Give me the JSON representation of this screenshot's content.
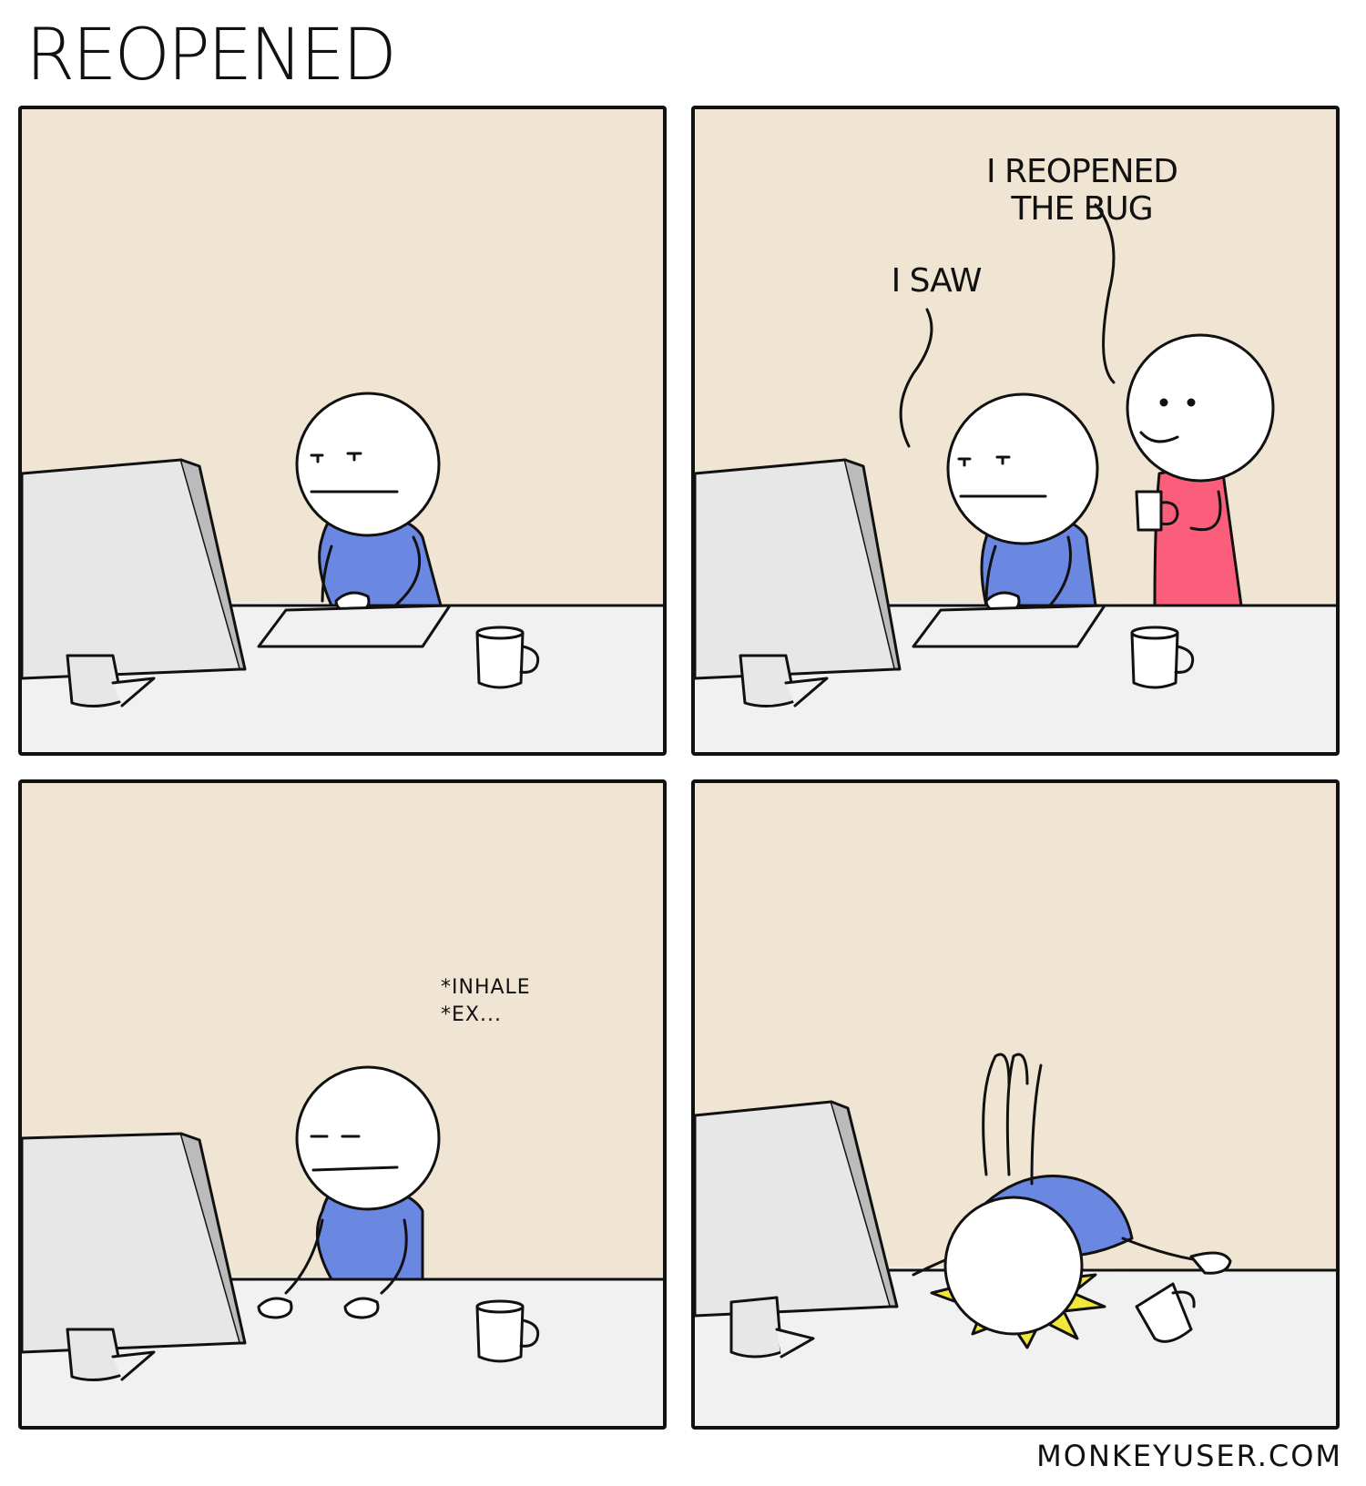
{
  "comic": {
    "title": "REOPENED",
    "panels": [
      {
        "id": 1,
        "dialogue": []
      },
      {
        "id": 2,
        "dialogue": [
          {
            "speaker": "coworker",
            "text_line1": "I REOPENED",
            "text_line2": "THE BUG"
          },
          {
            "speaker": "developer",
            "text": "I SAW"
          }
        ]
      },
      {
        "id": 3,
        "dialogue": [
          {
            "speaker": "developer",
            "text_line1": "*INHALE",
            "text_line2": "*EX..."
          }
        ]
      },
      {
        "id": 4,
        "dialogue": []
      }
    ],
    "credit": "MONKEYUSER.COM"
  },
  "colors": {
    "wall": "#f0e5d2",
    "desk": "#f1f1f1",
    "outline": "#111111",
    "shirt_developer": "#6a87e2",
    "shirt_coworker": "#fa5e7a",
    "impact": "#f1e63a",
    "monitor": "#e7e7e7"
  }
}
